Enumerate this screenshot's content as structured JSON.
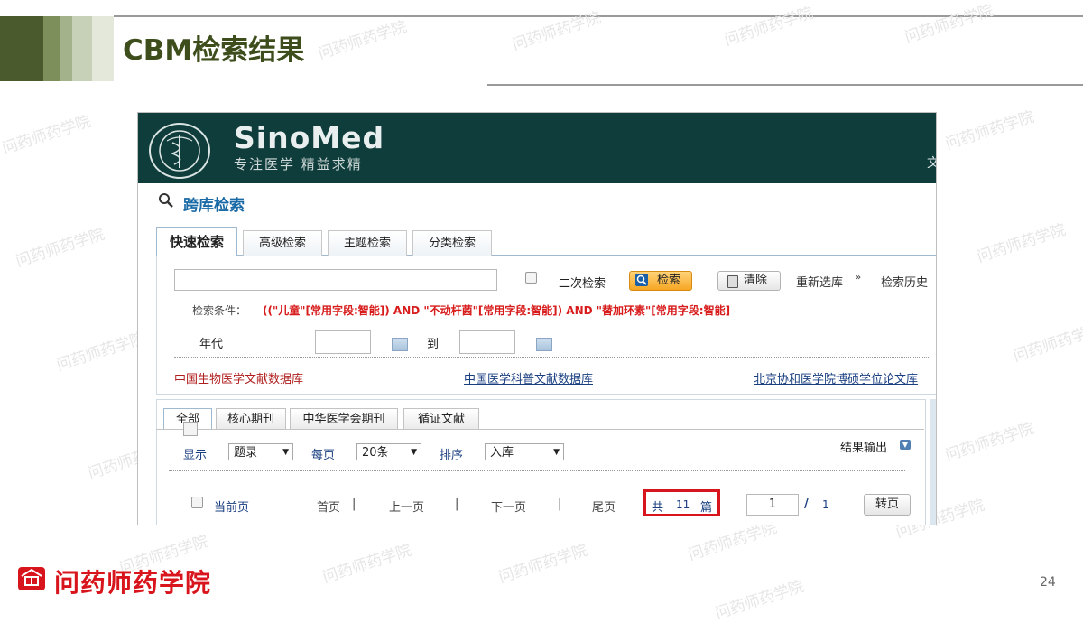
{
  "slide": {
    "title": "CBM检索结果",
    "page_number": "24",
    "footer_brand": "问药师药学院",
    "watermark": "问药师药学院"
  },
  "colors": {
    "title": "#3d4d1c",
    "banner": "#0f3d3b",
    "condition": "#d81b1b",
    "highlight_box": "#d8141c",
    "link_blue": "#1a6aa6"
  },
  "sinomed": {
    "logo_text": "SinoMed",
    "logo_sub": "专注医学 精益求精",
    "banner_edge_char": "文",
    "cross_search_title": "跨库检索",
    "tabs": [
      "快速检索",
      "高级检索",
      "主题检索",
      "分类检索"
    ],
    "active_tab": "快速检索",
    "search_input_value": "",
    "secondary_search_label": "二次检索",
    "search_button": "检索",
    "clear_button": "清除",
    "reselect_db": "重新选库",
    "search_history": "检索历史",
    "condition_label": "检索条件：",
    "condition_value": "((\"儿童\"[常用字段:智能]) AND \"不动杆菌\"[常用字段:智能]) AND \"替加环素\"[常用字段:智能]",
    "year_label": "年代",
    "year_to": "到",
    "year_from_value": "",
    "year_to_value": "",
    "databases": [
      "中国生物医学文献数据库",
      "中国医学科普文献数据库",
      "北京协和医学院博硕学位论文库"
    ],
    "result_tabs": [
      "全部",
      "核心期刊",
      "中华医学会期刊",
      "循证文献"
    ],
    "active_result_tab": "全部",
    "display_label": "显示",
    "display_value": "题录",
    "per_page_label": "每页",
    "per_page_value": "20条",
    "sort_label": "排序",
    "sort_value": "入库",
    "export_label": "结果输出",
    "current_page_label": "当前页",
    "pager": {
      "first": "首页",
      "prev": "上一页",
      "next": "下一页",
      "last": "尾页",
      "sep": "|",
      "total_prefix": "共",
      "total_count": "11",
      "total_suffix": "篇",
      "page_input_value": "1",
      "slash": "/",
      "total_pages": "1",
      "go_button": "转页"
    }
  }
}
